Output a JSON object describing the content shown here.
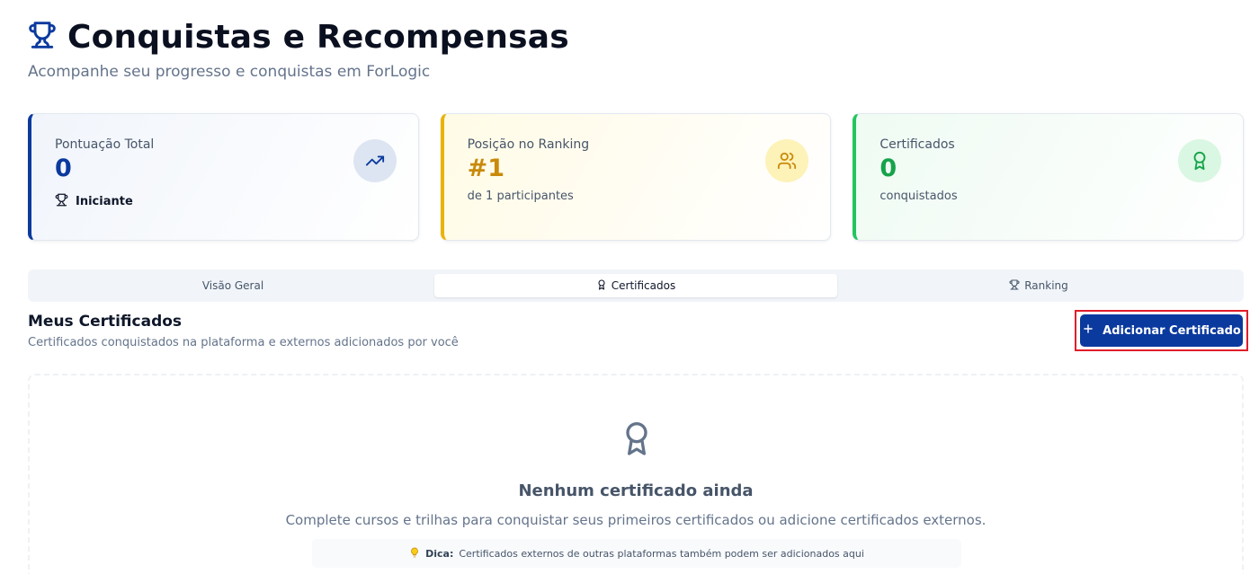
{
  "header": {
    "title": "Conquistas e Recompensas",
    "subtitle": "Acompanhe seu progresso e conquistas em ForLogic",
    "icon": "trophy-icon"
  },
  "stats": {
    "points": {
      "label": "Pontuação Total",
      "value": "0",
      "level": "Iniciante",
      "icon": "trending-up-icon"
    },
    "ranking": {
      "label": "Posição no Ranking",
      "value": "#1",
      "sub": "de 1 participantes",
      "icon": "users-icon"
    },
    "certificates": {
      "label": "Certificados",
      "value": "0",
      "sub": "conquistados",
      "icon": "award-icon"
    }
  },
  "tabs": [
    {
      "label": "Visão Geral",
      "active": false
    },
    {
      "label": "Certificados",
      "active": true
    },
    {
      "label": "Ranking",
      "active": false
    }
  ],
  "section": {
    "title": "Meus Certificados",
    "description": "Certificados conquistados na plataforma e externos adicionados por você",
    "add_button": "Adicionar Certificado"
  },
  "empty_state": {
    "title": "Nenhum certificado ainda",
    "description": "Complete cursos e trilhas para conquistar seus primeiros certificados ou adicione certificados externos.",
    "tip_label": "Dica:",
    "tip_text": "Certificados externos de outras plataformas também podem ser adicionados aqui"
  },
  "colors": {
    "primary": "#0b3a9e",
    "ranking_accent": "#eab308",
    "certificate_accent": "#22c55e",
    "highlight_border": "#e11d2a"
  }
}
